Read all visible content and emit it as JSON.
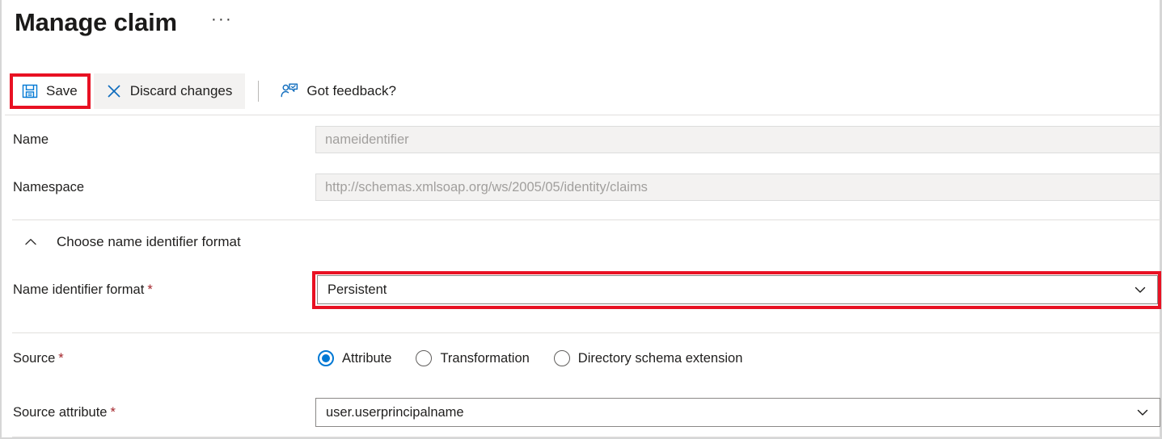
{
  "header": {
    "title": "Manage claim",
    "more_menu": "···"
  },
  "toolbar": {
    "save_label": "Save",
    "discard_label": "Discard changes",
    "feedback_label": "Got feedback?"
  },
  "form": {
    "name": {
      "label": "Name",
      "value": "nameidentifier"
    },
    "namespace": {
      "label": "Namespace",
      "value": "http://schemas.xmlsoap.org/ws/2005/05/identity/claims"
    },
    "section": {
      "title": "Choose name identifier format"
    },
    "name_identifier_format": {
      "label": "Name identifier format",
      "required_mark": "*",
      "value": "Persistent"
    },
    "source": {
      "label": "Source",
      "required_mark": "*",
      "options": [
        {
          "label": "Attribute",
          "selected": true
        },
        {
          "label": "Transformation",
          "selected": false
        },
        {
          "label": "Directory schema extension",
          "selected": false
        }
      ]
    },
    "source_attribute": {
      "label": "Source attribute",
      "required_mark": "*",
      "value": "user.userprincipalname"
    }
  },
  "icons": {
    "save": "save-floppy-icon",
    "discard": "close-x-icon",
    "feedback": "person-feedback-icon",
    "collapse": "chevron-up-icon",
    "dropdown": "chevron-down-icon"
  },
  "colors": {
    "accent": "#0078d4",
    "highlight": "#e81123",
    "required": "#a4262c"
  }
}
